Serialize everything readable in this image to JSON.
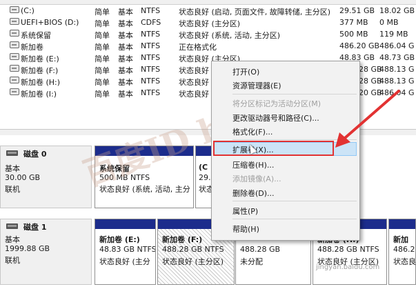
{
  "volumes": [
    {
      "name": "(C:)",
      "layout": "简单",
      "type": "基本",
      "fs": "NTFS",
      "status": "状态良好 (启动, 页面文件, 故障转储, 主分区)",
      "capacity": "29.51 GB",
      "free": "18.02 GB"
    },
    {
      "name": "UEFI+BIOS (D:)",
      "layout": "简单",
      "type": "基本",
      "fs": "CDFS",
      "status": "状态良好 (主分区)",
      "capacity": "377 MB",
      "free": "0 MB"
    },
    {
      "name": "系统保留",
      "layout": "简单",
      "type": "基本",
      "fs": "NTFS",
      "status": "状态良好 (系统, 活动, 主分区)",
      "capacity": "500 MB",
      "free": "119 MB"
    },
    {
      "name": "新加卷",
      "layout": "简单",
      "type": "基本",
      "fs": "NTFS",
      "status": "正在格式化",
      "capacity": "486.20 GB",
      "free": "486.04 G"
    },
    {
      "name": "新加卷 (E:)",
      "layout": "简单",
      "type": "基本",
      "fs": "NTFS",
      "status": "状态良好 (主分区)",
      "capacity": "48.83 GB",
      "free": "48.73 GB"
    },
    {
      "name": "新加卷 (F:)",
      "layout": "简单",
      "type": "基本",
      "fs": "NTFS",
      "status": "状态良好",
      "capacity": "28 GB",
      "free": "488.13 G"
    },
    {
      "name": "新加卷 (H:)",
      "layout": "简单",
      "type": "基本",
      "fs": "NTFS",
      "status": "状态良好",
      "capacity": "28 GB",
      "free": "488.13 G"
    },
    {
      "name": "新加卷 (I:)",
      "layout": "简单",
      "type": "基本",
      "fs": "NTFS",
      "status": "状态良好",
      "capacity": "20 GB",
      "free": "486.04 G"
    }
  ],
  "disk0": {
    "title": "磁盘 0",
    "type": "基本",
    "size": "30.00 GB",
    "state": "联机",
    "p1": {
      "name": "系统保留",
      "size": "500 MB NTFS",
      "status": "状态良好 (系统, 活动, 主分"
    },
    "p2": {
      "name": "(C",
      "size": "29.5",
      "status": "状态"
    }
  },
  "disk1": {
    "title": "磁盘 1",
    "type": "基本",
    "size": "1999.88 GB",
    "state": "联机",
    "p1": {
      "name": "新加卷  (E:)",
      "size": "48.83 GB NTFS",
      "status": "状态良好 (主分"
    },
    "p2": {
      "name": "新加卷  (F:)",
      "size": "488.28 GB NTFS",
      "status": "状态良好 (主分区)"
    },
    "p3": {
      "size": "488.28 GB",
      "status": "未分配"
    },
    "p4": {
      "name": "新加卷  (H:)",
      "size": "488.28 GB NTFS",
      "status": "状态良好 (主分区)"
    },
    "p5": {
      "name": "新加",
      "size": "486.2",
      "status": "状态良"
    }
  },
  "menu": {
    "open": "打开(O)",
    "explorer": "资源管理器(E)",
    "mark_active": "将分区标记为活动分区(M)",
    "change_letter": "更改驱动器号和路径(C)...",
    "format": "格式化(F)...",
    "extend": "扩展卷(X)...",
    "shrink": "压缩卷(H)...",
    "add_mirror": "添加镜像(A)...",
    "delete": "删除卷(D)...",
    "properties": "属性(P)",
    "help": "帮助(H)"
  },
  "watermark": {
    "text": "百度ID bu0zi",
    "site": "jingyan.baidu.com"
  },
  "colors": {
    "partition_bar": "#1c2c8c",
    "highlight": "#cce4f7",
    "annotation": "#e23232"
  }
}
